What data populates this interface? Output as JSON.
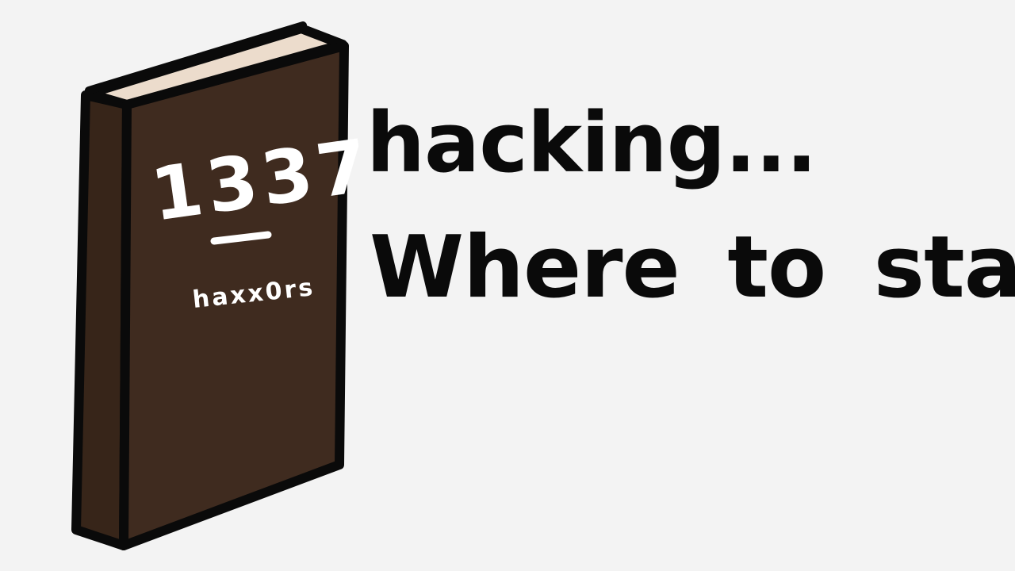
{
  "book": {
    "title": "1337",
    "subtitle": "haxx0rs",
    "colors": {
      "cover": "#3f2b1f",
      "spine": "#372519",
      "pages": "#ecdccc",
      "outline": "#0a0a0a",
      "lettering": "#ffffff"
    }
  },
  "caption": {
    "line1": "hacking...",
    "line2": "Where to start?"
  },
  "background_color": "#f3f3f3"
}
